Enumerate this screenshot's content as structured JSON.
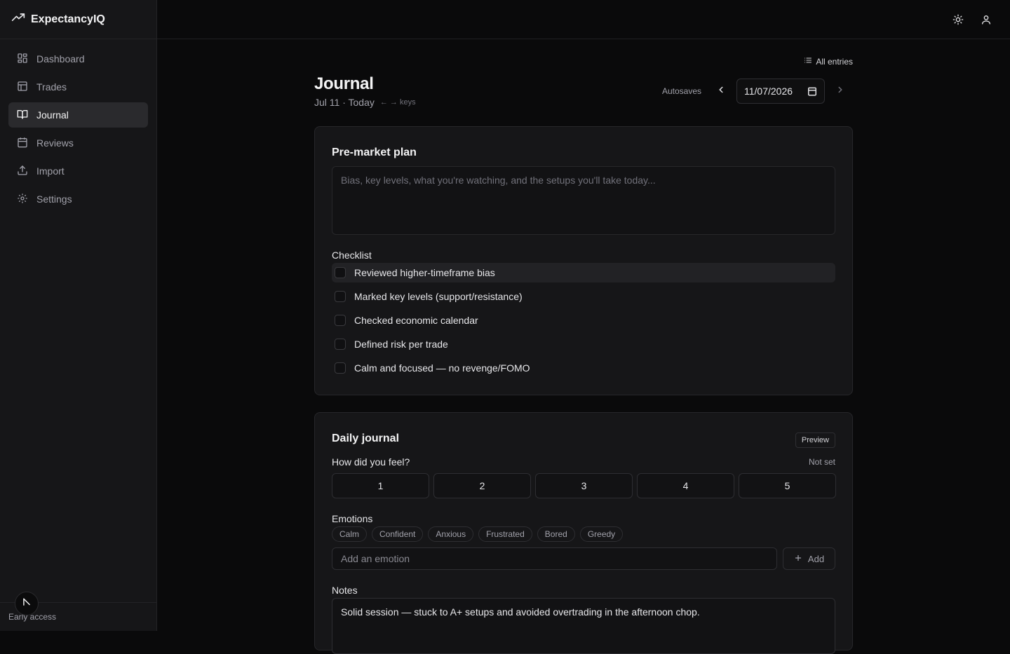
{
  "app": {
    "name": "ExpectancyIQ",
    "early_access": "Early access"
  },
  "sidebar": {
    "items": [
      {
        "label": "Dashboard",
        "icon": "dashboard-icon"
      },
      {
        "label": "Trades",
        "icon": "table-icon"
      },
      {
        "label": "Journal",
        "icon": "book-icon",
        "active": true
      },
      {
        "label": "Reviews",
        "icon": "calendar-icon"
      },
      {
        "label": "Import",
        "icon": "upload-icon"
      },
      {
        "label": "Settings",
        "icon": "gear-icon"
      }
    ]
  },
  "topbar": {
    "icons": [
      "sun-icon",
      "user-icon"
    ]
  },
  "header": {
    "all_entries": "All entries",
    "title": "Journal",
    "subtitle": "Jul 11 · Today",
    "keys_hint": "← → keys",
    "autosaves": "Autosaves",
    "date_value": "11/07/2026"
  },
  "premarket": {
    "title": "Pre-market plan",
    "placeholder": "Bias, key levels, what you're watching, and the setups you'll take today...",
    "checklist_label": "Checklist",
    "checklist": [
      "Reviewed higher-timeframe bias",
      "Marked key levels (support/resistance)",
      "Checked economic calendar",
      "Defined risk per trade",
      "Calm and focused — no revenge/FOMO"
    ]
  },
  "daily": {
    "title": "Daily journal",
    "preview_label": "Preview",
    "feel_label": "How did you feel?",
    "feel_status": "Not set",
    "ratings": [
      "1",
      "2",
      "3",
      "4",
      "5"
    ],
    "emotions_label": "Emotions",
    "emotions": [
      "Calm",
      "Confident",
      "Anxious",
      "Frustrated",
      "Bored",
      "Greedy"
    ],
    "emotion_placeholder": "Add an emotion",
    "add_label": "Add",
    "notes_label": "Notes",
    "notes_value": "Solid session — stuck to A+ setups and avoided overtrading in the afternoon chop."
  },
  "colors": {
    "background": "#0a0a0b",
    "sidebar": "#161618",
    "active": "#2a2a2d",
    "border": "#27272a"
  }
}
